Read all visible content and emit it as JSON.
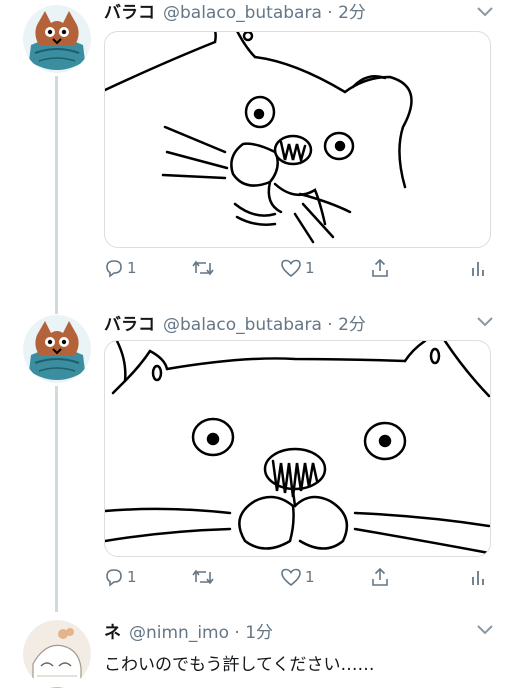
{
  "tweets": [
    {
      "name": "バラコ",
      "handle_time": "@balaco_butabara · 2分",
      "reply_count": "1",
      "retweet_count": "",
      "like_count": "1"
    },
    {
      "name": "バラコ",
      "handle_time": "@balaco_butabara · 2分",
      "reply_count": "1",
      "retweet_count": "",
      "like_count": "1"
    }
  ],
  "reply": {
    "name": "ネ",
    "handle_time": "@nimn_imo · 1分",
    "text": "こわいのでもう許してください……"
  },
  "colors": {
    "text": "#14171a",
    "secondary": "#657786",
    "thread_line": "#cfd9de"
  },
  "icons": [
    "reply-icon",
    "retweet-icon",
    "like-icon",
    "share-icon",
    "analytics-icon",
    "chevron-down-icon"
  ]
}
